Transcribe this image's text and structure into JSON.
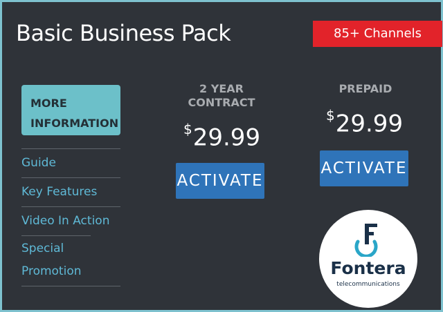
{
  "header": {
    "title": "Basic Business Pack",
    "badge": "85+ Channels"
  },
  "sidebar": {
    "more_info_button": "MORE INFORMATION",
    "items": [
      {
        "label": "Guide"
      },
      {
        "label": "Key Features"
      },
      {
        "label": "Video In Action"
      },
      {
        "label": "Special Promotion"
      }
    ]
  },
  "plans": [
    {
      "name": "2 YEAR CONTRACT",
      "currency": "$",
      "price": "29.99",
      "button": "ACTIVATE"
    },
    {
      "name": "PREPAID",
      "currency": "$",
      "price": "29.99",
      "button": "ACTIVATE"
    }
  ],
  "logo": {
    "name": "Fontera",
    "tagline": "telecommunications",
    "icon": "fontera-logo-icon",
    "colors": {
      "brand": "#1a3048",
      "accent": "#2aa6c8"
    }
  },
  "colors": {
    "background": "#2f3339",
    "border": "#7ec2cf",
    "badge": "#e2232a",
    "more_button": "#6cc0c9",
    "nav_link": "#5fb9d6",
    "activate_button": "#2f74b9"
  }
}
